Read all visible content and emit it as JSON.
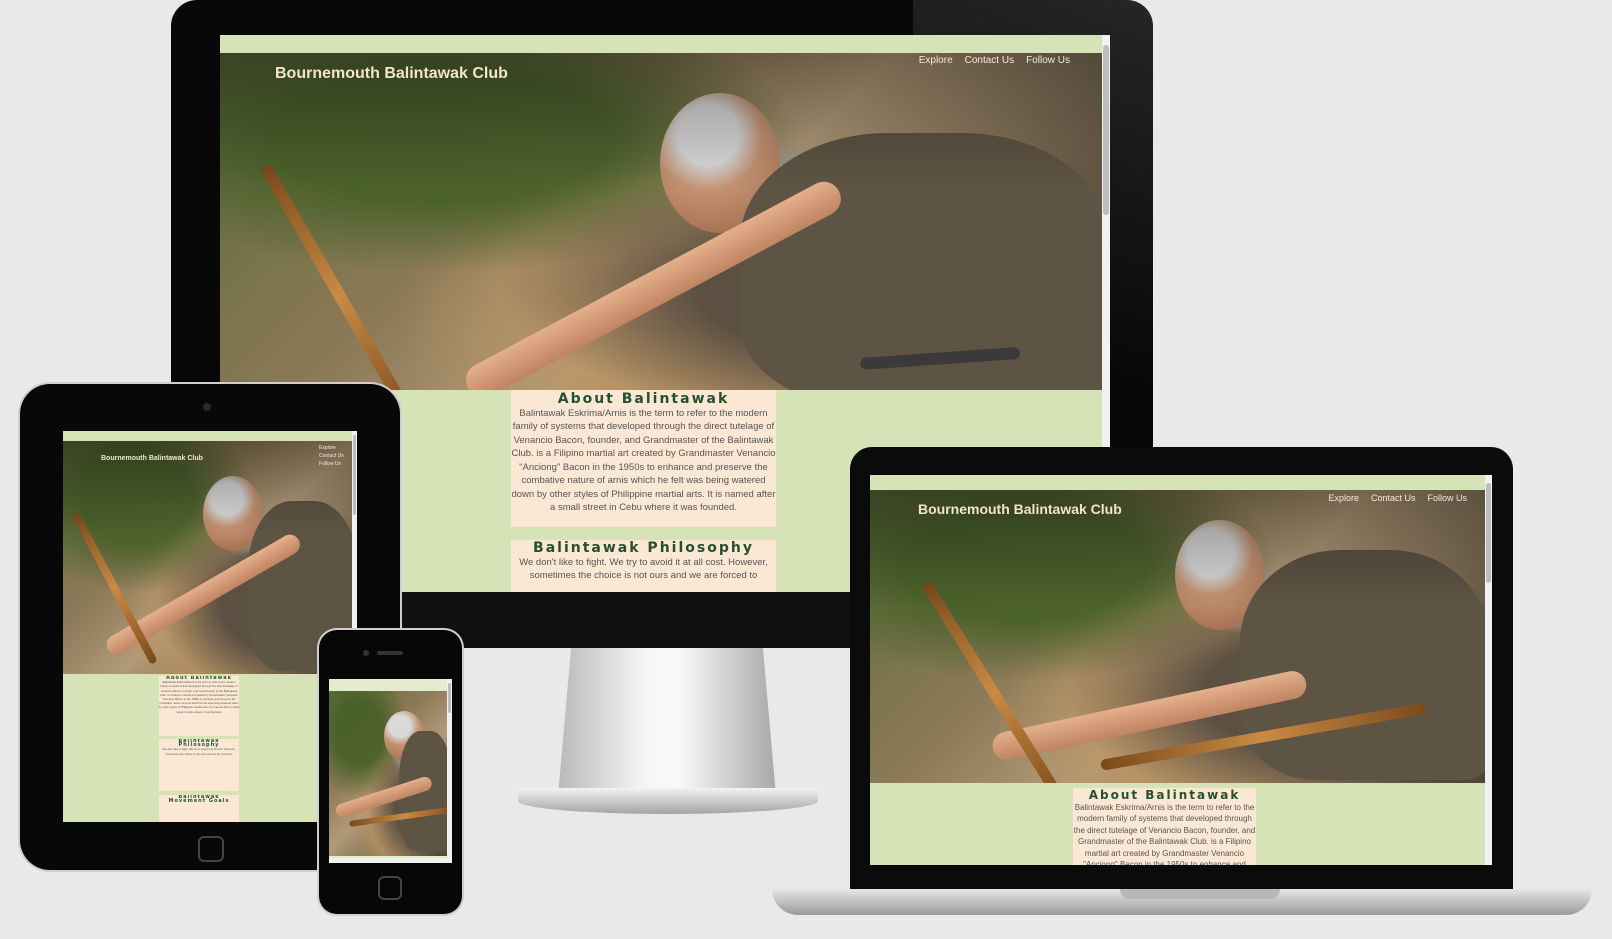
{
  "site": {
    "brand": "Bournemouth Balintawak Club",
    "nav": [
      "Explore",
      "Contact Us",
      "Follow Us"
    ],
    "sections": [
      {
        "title": "About Balintawak",
        "body": "Balintawak Eskrima/Arnis is the term to refer to the modern family of systems that developed through the direct tutelage of Venancio Bacon, founder, and Grandmaster of the Balintawak Club. is a Filipino martial art created by Grandmaster Venancio \"Anciong\" Bacon in the 1950s to enhance and preserve the combative nature of arnis which he felt was being watered down by other styles of Philippine martial arts. It is named after a small street in Cebu where it was founded."
      },
      {
        "title": "Balintawak Philosophy",
        "body": "We don't like to fight. We try to avoid it at all cost. However, sometimes the choice is not ours and we are forced to"
      },
      {
        "title": "Balintawak Movement Goals",
        "body": ""
      }
    ]
  },
  "colors": {
    "page_bg": "#d6e3b6",
    "card_bg": "#fae8d4",
    "heading": "#25502e",
    "nav_text": "#f4ebd9"
  }
}
